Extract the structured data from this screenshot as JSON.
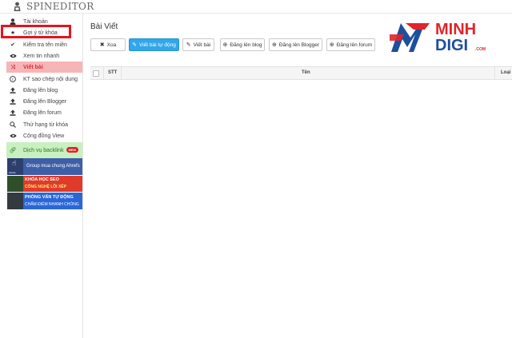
{
  "app": {
    "name": "SPINEDITOR"
  },
  "sidebar": {
    "items": [
      {
        "label": "Tài khoản",
        "icon": "user-icon"
      },
      {
        "label": "Gợi ý từ khóa",
        "icon": "star-icon"
      },
      {
        "label": "Kiểm tra tên miền",
        "icon": "check-icon"
      },
      {
        "label": "Xem tin nhanh",
        "icon": "eye-icon"
      },
      {
        "label": "Viết bài",
        "icon": "shuffle-icon"
      },
      {
        "label": "KT sao chép nội dung",
        "icon": "copyright-icon"
      },
      {
        "label": "Đăng lên blog",
        "icon": "upload-icon"
      },
      {
        "label": "Đăng lên Blogger",
        "icon": "upload-icon"
      },
      {
        "label": "Đăng lên forum",
        "icon": "upload-icon"
      },
      {
        "label": "Thứ hạng từ khóa",
        "icon": "search-icon"
      },
      {
        "label": "Cộng đồng View",
        "icon": "eye-icon"
      }
    ],
    "backlink": {
      "label": "Dịch vụ backlink",
      "badge": "NEW"
    },
    "banners": [
      {
        "thumb_label": "Ahrefs",
        "text": "Group mua chung Ahrefs"
      },
      {
        "line1": "KHÓA HỌC SEO",
        "line2": "CÔNG NGHỆ LÕI XẾP"
      },
      {
        "line1": "PHỎNG VẤN TỰ ĐỘNG",
        "line2": "CHẤM ĐIỂM NHANH CHÓNG"
      }
    ]
  },
  "main": {
    "title": "Bài Viết",
    "buttons": [
      {
        "label": "Xoa",
        "icon": "close-icon"
      },
      {
        "label": "Viết bài tự động",
        "icon": "pencil-icon"
      },
      {
        "label": "Viết bài",
        "icon": "pencil-icon"
      },
      {
        "label": "Đăng lên blog",
        "icon": "circle-arrow-icon"
      },
      {
        "label": "Đăng lên Blogger",
        "icon": "circle-arrow-icon"
      },
      {
        "label": "Đăng lên forum",
        "icon": "circle-arrow-icon"
      }
    ],
    "table": {
      "columns": [
        "STT",
        "Tên",
        "Loại"
      ]
    }
  },
  "brand": {
    "line1": "MINH",
    "line2": "DIGI",
    "suffix": ".COM",
    "color_red": "#e0252b",
    "color_blue": "#1d4f9c"
  },
  "colors": {
    "primary": "#32a6eb",
    "active_bg": "#f7b5b8",
    "active_text": "#e02e36",
    "highlight": "#e5141e"
  }
}
